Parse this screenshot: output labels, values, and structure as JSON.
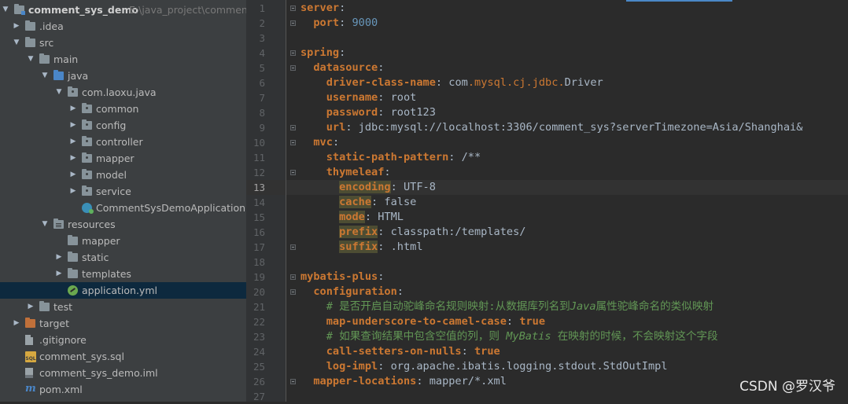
{
  "project": {
    "name": "comment_sys_demo",
    "path": "E:\\java_project\\comment_s"
  },
  "tree": [
    {
      "label": "comment_sys_demo",
      "level": 0,
      "arrow": "open",
      "icon": "module-folder"
    },
    {
      "label": ".idea",
      "level": 1,
      "arrow": "closed",
      "icon": "folder"
    },
    {
      "label": "src",
      "level": 1,
      "arrow": "open",
      "icon": "folder"
    },
    {
      "label": "main",
      "level": 2,
      "arrow": "open",
      "icon": "folder"
    },
    {
      "label": "java",
      "level": 3,
      "arrow": "open",
      "icon": "source-folder"
    },
    {
      "label": "com.laoxu.java",
      "level": 4,
      "arrow": "open",
      "icon": "package-folder"
    },
    {
      "label": "common",
      "level": 5,
      "arrow": "closed",
      "icon": "package-folder"
    },
    {
      "label": "config",
      "level": 5,
      "arrow": "closed",
      "icon": "package-folder"
    },
    {
      "label": "controller",
      "level": 5,
      "arrow": "closed",
      "icon": "package-folder"
    },
    {
      "label": "mapper",
      "level": 5,
      "arrow": "closed",
      "icon": "package-folder"
    },
    {
      "label": "model",
      "level": 5,
      "arrow": "closed",
      "icon": "package-folder"
    },
    {
      "label": "service",
      "level": 5,
      "arrow": "closed",
      "icon": "package-folder"
    },
    {
      "label": "CommentSysDemoApplication",
      "level": 5,
      "arrow": "none",
      "icon": "spring-class"
    },
    {
      "label": "resources",
      "level": 3,
      "arrow": "open",
      "icon": "resources-folder"
    },
    {
      "label": "mapper",
      "level": 4,
      "arrow": "none",
      "icon": "folder"
    },
    {
      "label": "static",
      "level": 4,
      "arrow": "closed",
      "icon": "folder"
    },
    {
      "label": "templates",
      "level": 4,
      "arrow": "closed",
      "icon": "folder"
    },
    {
      "label": "application.yml",
      "level": 4,
      "arrow": "none",
      "icon": "yml-file",
      "selected": true
    },
    {
      "label": "test",
      "level": 2,
      "arrow": "closed",
      "icon": "folder"
    },
    {
      "label": "target",
      "level": 1,
      "arrow": "closed",
      "icon": "excluded-folder"
    },
    {
      "label": ".gitignore",
      "level": 1,
      "arrow": "none",
      "icon": "text-file"
    },
    {
      "label": "comment_sys.sql",
      "level": 1,
      "arrow": "none",
      "icon": "sql-file"
    },
    {
      "label": "comment_sys_demo.iml",
      "level": 1,
      "arrow": "none",
      "icon": "iml-file"
    },
    {
      "label": "pom.xml",
      "level": 1,
      "arrow": "none",
      "icon": "maven-file"
    }
  ],
  "editor": {
    "current_line": 13,
    "lines": [
      [
        [
          "k",
          "server"
        ],
        [
          "v",
          ":"
        ]
      ],
      [
        [
          "v",
          "  "
        ],
        [
          "k",
          "port"
        ],
        [
          "v",
          ": "
        ],
        [
          "n",
          "9000"
        ]
      ],
      [],
      [
        [
          "k",
          "spring"
        ],
        [
          "v",
          ":"
        ]
      ],
      [
        [
          "v",
          "  "
        ],
        [
          "k",
          "datasource"
        ],
        [
          "v",
          ":"
        ]
      ],
      [
        [
          "v",
          "    "
        ],
        [
          "k",
          "driver-class-name"
        ],
        [
          "v",
          ": "
        ],
        [
          "pk",
          "com"
        ],
        [
          "dot",
          "."
        ],
        [
          "pr",
          "mysql"
        ],
        [
          "dot",
          "."
        ],
        [
          "pr",
          "cj"
        ],
        [
          "dot",
          "."
        ],
        [
          "pr",
          "jdbc"
        ],
        [
          "dot",
          "."
        ],
        [
          "cls-t",
          "Driver"
        ]
      ],
      [
        [
          "v",
          "    "
        ],
        [
          "k",
          "username"
        ],
        [
          "v",
          ": root"
        ]
      ],
      [
        [
          "v",
          "    "
        ],
        [
          "k",
          "password"
        ],
        [
          "v",
          ": root123"
        ]
      ],
      [
        [
          "v",
          "    "
        ],
        [
          "k",
          "url"
        ],
        [
          "v",
          ": jdbc:mysql://localhost:3306/comment_sys?serverTimezone=Asia/Shanghai&"
        ]
      ],
      [
        [
          "v",
          "  "
        ],
        [
          "k",
          "mvc"
        ],
        [
          "v",
          ":"
        ]
      ],
      [
        [
          "v",
          "    "
        ],
        [
          "k",
          "static-path-pattern"
        ],
        [
          "v",
          ": /**"
        ]
      ],
      [
        [
          "v",
          "    "
        ],
        [
          "k",
          "thymeleaf"
        ],
        [
          "v",
          ":"
        ]
      ],
      [
        [
          "v",
          "      "
        ],
        [
          "k hk",
          "encoding"
        ],
        [
          "v",
          ": UTF-8"
        ]
      ],
      [
        [
          "v",
          "      "
        ],
        [
          "k hk",
          "cache"
        ],
        [
          "v",
          ": false"
        ]
      ],
      [
        [
          "v",
          "      "
        ],
        [
          "k hk",
          "mode"
        ],
        [
          "v",
          ": HTML"
        ]
      ],
      [
        [
          "v",
          "      "
        ],
        [
          "k hk",
          "prefix"
        ],
        [
          "v",
          ": classpath:/templates/"
        ]
      ],
      [
        [
          "v",
          "      "
        ],
        [
          "k hk",
          "suffix"
        ],
        [
          "v",
          ": .html"
        ]
      ],
      [],
      [
        [
          "k",
          "mybatis-plus"
        ],
        [
          "v",
          ":"
        ]
      ],
      [
        [
          "v",
          "  "
        ],
        [
          "k",
          "configuration"
        ],
        [
          "v",
          ":"
        ]
      ],
      [
        [
          "v",
          "    "
        ],
        [
          "cm",
          "# 是否开启自动驼峰命名规则映射:从数据库列名到"
        ],
        [
          "cmi",
          "Java"
        ],
        [
          "cm",
          "属性驼峰命名的类似映射"
        ]
      ],
      [
        [
          "v",
          "    "
        ],
        [
          "k",
          "map-underscore-to-camel-case"
        ],
        [
          "v",
          ": "
        ],
        [
          "k",
          "true"
        ]
      ],
      [
        [
          "v",
          "    "
        ],
        [
          "cm",
          "# 如果查询结果中包含空值的列，则 "
        ],
        [
          "cmi",
          "MyBatis"
        ],
        [
          "cm",
          " 在映射的时候，不会映射这个字段"
        ]
      ],
      [
        [
          "v",
          "    "
        ],
        [
          "k",
          "call-setters-on-nulls"
        ],
        [
          "v",
          ": "
        ],
        [
          "k",
          "true"
        ]
      ],
      [
        [
          "v",
          "    "
        ],
        [
          "k",
          "log-impl"
        ],
        [
          "v",
          ": org.apache.ibatis.logging.stdout.StdOutImpl"
        ]
      ],
      [
        [
          "v",
          "  "
        ],
        [
          "k",
          "mapper-locations"
        ],
        [
          "v",
          ": mapper/*.xml"
        ]
      ],
      []
    ]
  },
  "watermark": "CSDN @罗汉爷"
}
